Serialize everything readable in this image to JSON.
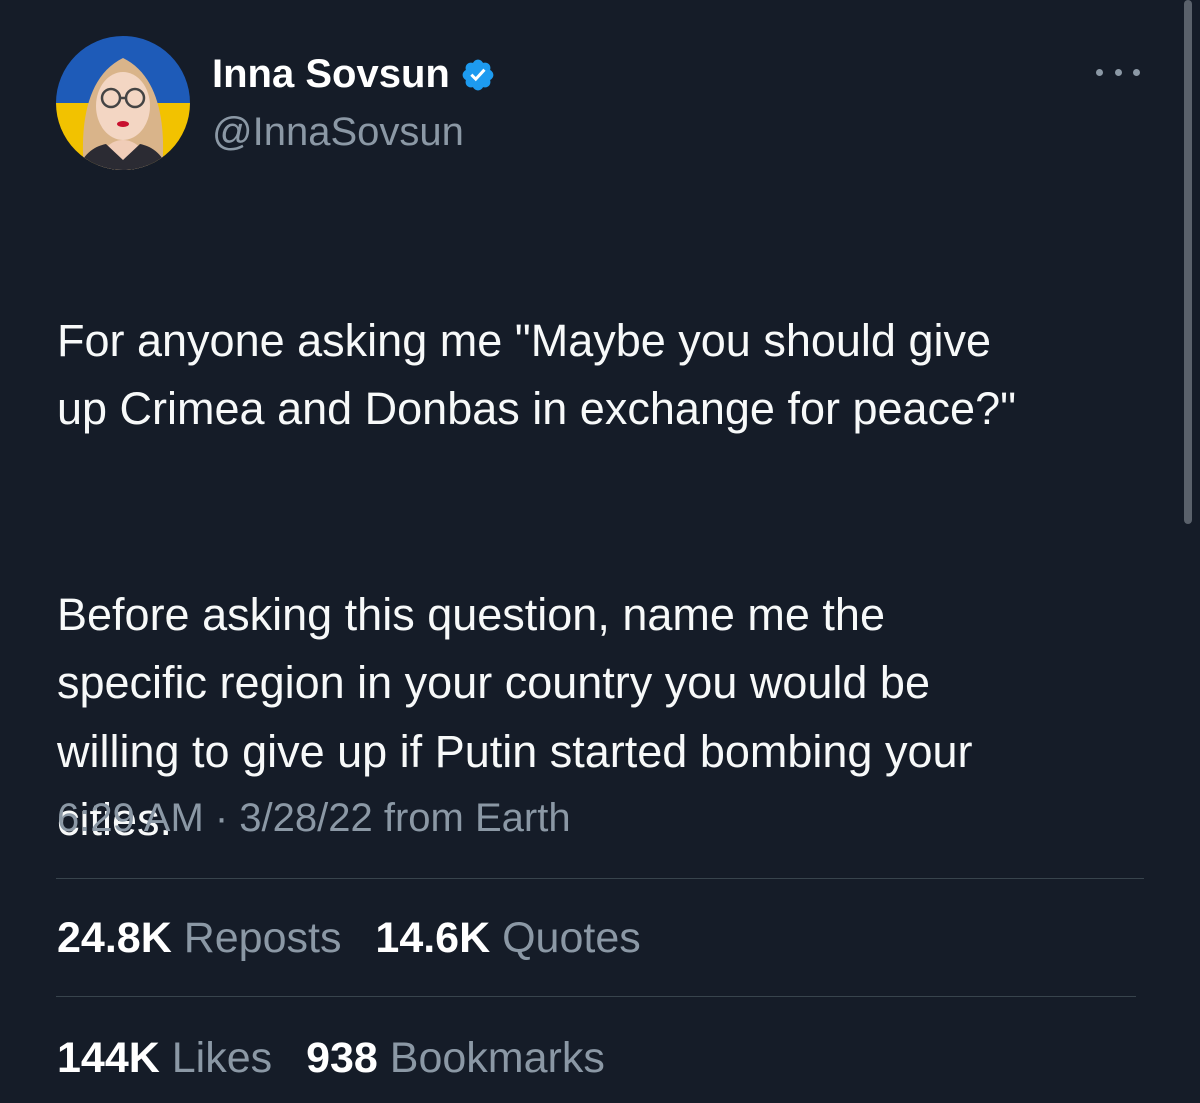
{
  "author": {
    "name": "Inna Sovsun",
    "handle": "@InnaSovsun",
    "verified": true,
    "avatar_background_colors": [
      "#1e5bb8",
      "#f2c200"
    ]
  },
  "icons": {
    "verified": "verified-badge-icon",
    "more": "more-options-icon"
  },
  "tweet": {
    "paragraphs": [
      "For anyone asking me \"Maybe you should give\nup Crimea and Donbas in exchange for peace?\"",
      "Before asking this question, name me the\nspecific region in your country you would be\nwilling to give up if Putin started bombing your\ncities."
    ],
    "meta": "6:29 AM · 3/28/22 from Earth"
  },
  "stats": {
    "reposts": {
      "count": "24.8K",
      "label": "Reposts"
    },
    "quotes": {
      "count": "14.6K",
      "label": "Quotes"
    },
    "likes": {
      "count": "144K",
      "label": "Likes"
    },
    "bookmarks": {
      "count": "938",
      "label": "Bookmarks"
    }
  },
  "colors": {
    "background": "#151c28",
    "text": "#ffffff",
    "secondary_text": "#8b98a5",
    "verified_blue": "#1d9bf0",
    "divider": "#38444d"
  }
}
